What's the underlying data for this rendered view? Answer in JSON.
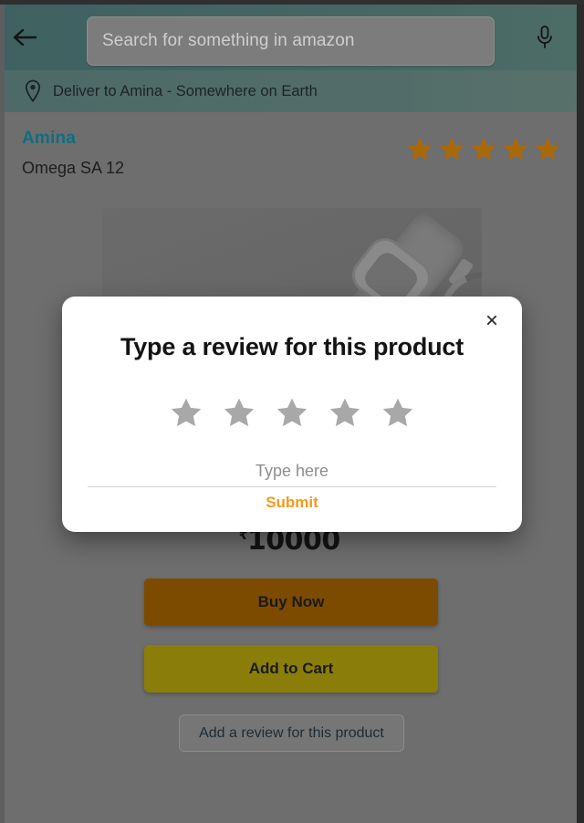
{
  "topbar": {
    "back_icon": "back-arrow-icon",
    "search_placeholder": "Search for something in amazon",
    "search_value": "",
    "mic_icon": "microphone-icon",
    "bg_color": "#3f6161"
  },
  "deliver": {
    "pin_icon": "location-pin-icon",
    "text": "Deliver to Amina - Somewhere on Earth",
    "bg_color": "#4d6a68"
  },
  "product": {
    "seller": "Amina",
    "seller_color": "#0f6e82",
    "title": "Omega SA 12",
    "rating": 5,
    "rating_star_color": "#a9690b",
    "price_currency": "₹",
    "price_amount": "10000",
    "price_superscript": "°",
    "image_icon": "watch-product-image"
  },
  "actions": {
    "buy_now": "Buy Now",
    "buy_now_color": "#7c4b00",
    "add_to_cart": "Add to Cart",
    "add_to_cart_color": "#8a7d09",
    "add_review": "Add a review for this product"
  },
  "modal": {
    "close_icon": "×",
    "title": "Type a review for this product",
    "stars_total": 5,
    "stars_selected": 0,
    "star_color": "#a8a8a8",
    "input_placeholder": "Type here",
    "input_value": "",
    "submit_label": "Submit",
    "submit_color": "#f7991c"
  }
}
